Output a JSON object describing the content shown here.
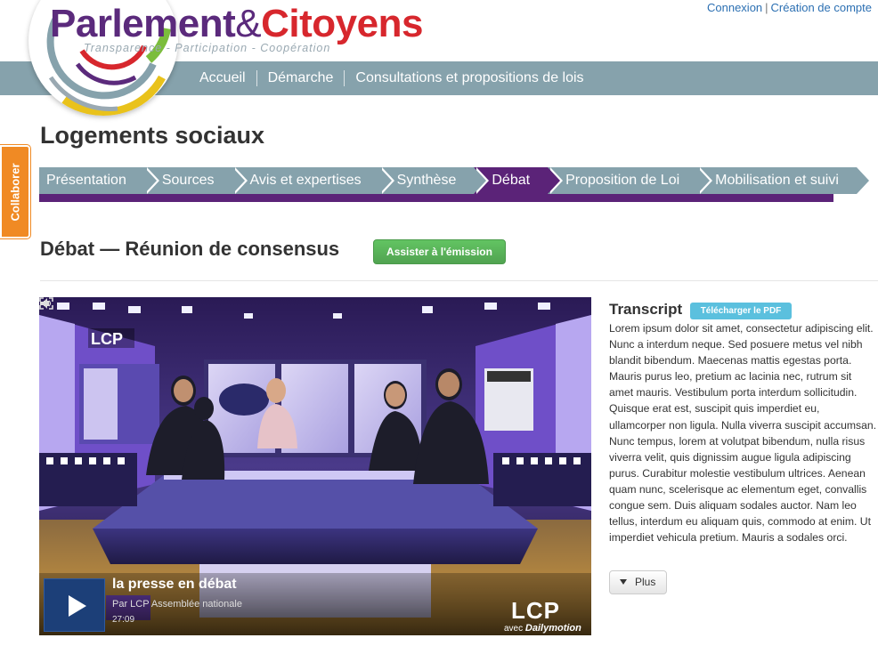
{
  "account": {
    "login": "Connexion",
    "separator": "|",
    "register": "Création de compte"
  },
  "logo": {
    "part1": "Parlement",
    "amp": "&",
    "part2": "Citoyens",
    "tagline": "Transparence - Participation - Coopération"
  },
  "nav": {
    "items": [
      "Accueil",
      "Démarche",
      "Consultations et propositions de lois"
    ]
  },
  "collaborer": {
    "label": "Collaborer"
  },
  "page": {
    "title": "Logements sociaux"
  },
  "steps": {
    "items": [
      "Présentation",
      "Sources",
      "Avis et expertises",
      "Synthèse",
      "Débat",
      "Proposition de Loi",
      "Mobilisation et suivi"
    ],
    "active_index": 4
  },
  "section": {
    "heading": "Débat — Réunion de consensus",
    "watch_button": "Assister à l'émission"
  },
  "video": {
    "title": "la presse en débat",
    "subtitle": "Par LCP Assemblée nationale",
    "duration": "27:09",
    "brand": "LCP",
    "channel_watermark": "LCP",
    "partner_prefix": "avec",
    "partner": "Dailymotion",
    "icons": [
      "play-icon",
      "volume-icon",
      "fullscreen-icon"
    ]
  },
  "transcript": {
    "title": "Transcript",
    "download_button": "Télécharger le PDF",
    "body": "Lorem ipsum dolor sit amet, consectetur adipiscing elit. Nunc a interdum neque. Sed posuere metus vel nibh blandit bibendum. Maecenas mattis egestas porta. Mauris purus leo, pretium ac lacinia nec, rutrum sit amet mauris. Vestibulum porta interdum sollicitudin. Quisque erat est, suscipit quis imperdiet eu, ullamcorper non ligula. Nulla viverra suscipit accumsan. Nunc tempus, lorem at volutpat bibendum, nulla risus viverra velit, quis dignissim augue ligula adipiscing purus. Curabitur molestie vestibulum ultrices. Aenean quam nunc, scelerisque ac elementum eget, convallis congue sem. Duis aliquam sodales auctor. Nam leo tellus, interdum eu aliquam quis, commodo at enim. Ut imperdiet vehicula pretium. Mauris a sodales orci.",
    "more_button": "Plus"
  },
  "colors": {
    "nav_bar": "#86a2ac",
    "step_active": "#5b2378",
    "logo_purple": "#5b2a7c",
    "logo_red": "#d7272d",
    "collab_orange": "#f08a24",
    "button_green": "#51a351",
    "button_info": "#5bc0de",
    "link_blue": "#2b6fb2"
  }
}
